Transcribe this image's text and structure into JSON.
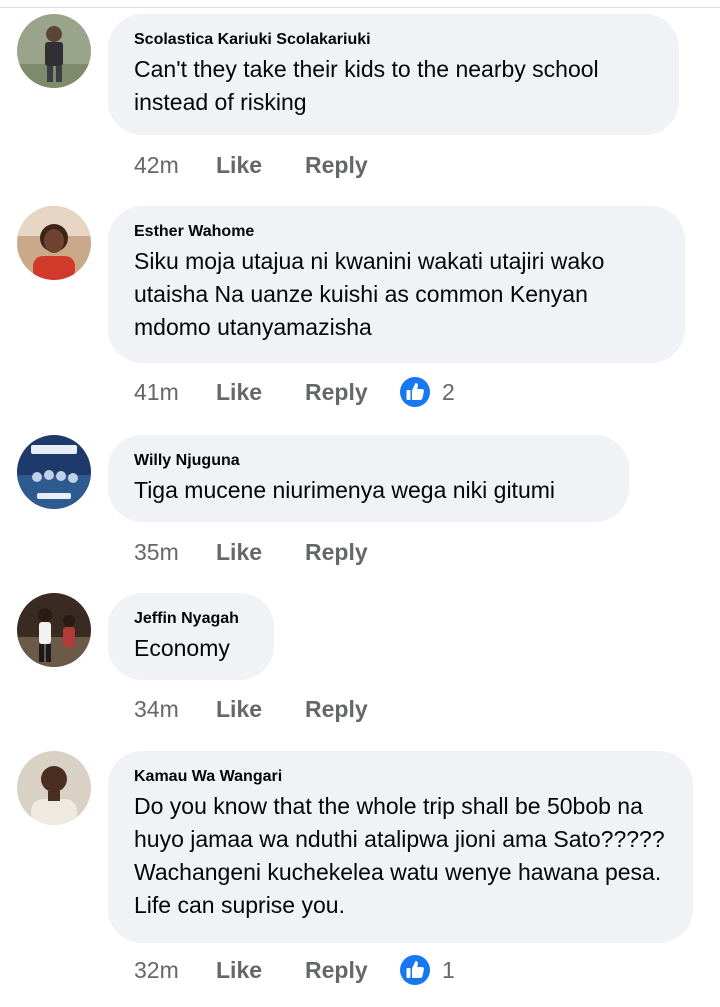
{
  "comments": [
    {
      "author": "Scolastica Kariuki Scolakariuki",
      "text": "Can't they take their kids to the nearby school instead of risking",
      "time": "42m",
      "like_label": "Like",
      "reply_label": "Reply",
      "reactions": null
    },
    {
      "author": "Esther Wahome",
      "text": "Siku moja utajua ni kwanini wakati utajiri wako utaisha Na uanze kuishi as common Kenyan mdomo utanyamazisha",
      "time": "41m",
      "like_label": "Like",
      "reply_label": "Reply",
      "reactions": "2"
    },
    {
      "author": "Willy Njuguna",
      "text": "Tiga mucene niurimenya wega niki gitumi",
      "time": "35m",
      "like_label": "Like",
      "reply_label": "Reply",
      "reactions": null
    },
    {
      "author": "Jeffin Nyagah",
      "text": "Economy",
      "time": "34m",
      "like_label": "Like",
      "reply_label": "Reply",
      "reactions": null
    },
    {
      "author": "Kamau Wa Wangari",
      "text": "Do you know that the whole trip shall be 50bob na huyo jamaa wa nduthi atalipwa jioni ama Sato????? Wachangeni kuchekelea watu wenye hawana pesa. Life can suprise you.",
      "time": "32m",
      "like_label": "Like",
      "reply_label": "Reply",
      "reactions": "1"
    }
  ],
  "colors": {
    "bubble": "#f0f2f5",
    "secondary_text": "#65676b",
    "like_blue": "#1877f2"
  },
  "icons": {
    "reaction": "thumbs-up-icon"
  }
}
